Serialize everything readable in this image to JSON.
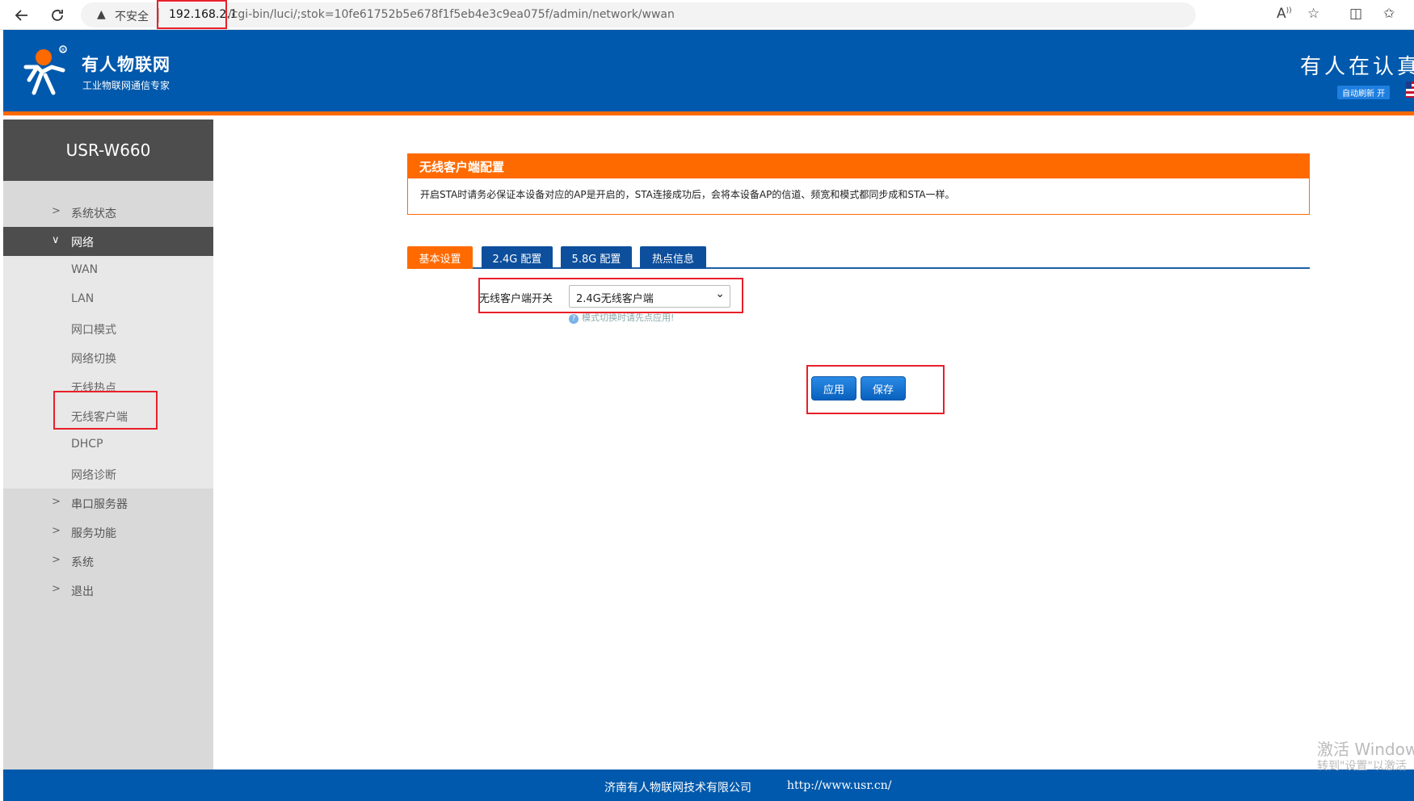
{
  "browser": {
    "security_label": "不安全",
    "url_host": "192.168.2.1",
    "url_path": "/cgi-bin/luci/;stok=10fe61752b5e678f1f5eb4e3c9ea075f/admin/network/wwan"
  },
  "header": {
    "brand": "有人物联网",
    "slogan": "工业物联网通信专家",
    "title": "有人在认真",
    "auto_refresh": "自动刷新 开"
  },
  "sidebar": {
    "device": "USR-W660",
    "menu": [
      {
        "label": "系统状态"
      },
      {
        "label": "网络"
      }
    ],
    "submenu": [
      {
        "label": "WAN"
      },
      {
        "label": "LAN"
      },
      {
        "label": "网口模式"
      },
      {
        "label": "网络切换"
      },
      {
        "label": "无线热点"
      },
      {
        "label": "无线客户端"
      },
      {
        "label": "DHCP"
      },
      {
        "label": "网络诊断"
      }
    ],
    "menu_rest": [
      {
        "label": "串口服务器"
      },
      {
        "label": "服务功能"
      },
      {
        "label": "系统"
      },
      {
        "label": "退出"
      }
    ]
  },
  "notice": {
    "title": "无线客户端配置",
    "text": "开启STA时请务必保证本设备对应的AP是开启的，STA连接成功后，会将本设备AP的信道、频宽和模式都同步成和STA一样。"
  },
  "tabs": [
    {
      "label": "基本设置",
      "active": true
    },
    {
      "label": "2.4G 配置",
      "active": false
    },
    {
      "label": "5.8G 配置",
      "active": false
    },
    {
      "label": "热点信息",
      "active": false
    }
  ],
  "form": {
    "switch_label": "无线客户端开关",
    "switch_value": "2.4G无线客户端",
    "hint": "模式切换时请先点应用!"
  },
  "buttons": {
    "apply": "应用",
    "save": "保存"
  },
  "footer": {
    "company": "济南有人物联网技术有限公司",
    "url": "http://www.usr.cn/"
  },
  "watermark": {
    "line1": "激活 Window",
    "line2": "转到\"设置\"以激活"
  },
  "colors": {
    "primary_blue": "#0059ac",
    "accent_orange": "#ff6a00",
    "annotation_red": "#e8202a"
  }
}
